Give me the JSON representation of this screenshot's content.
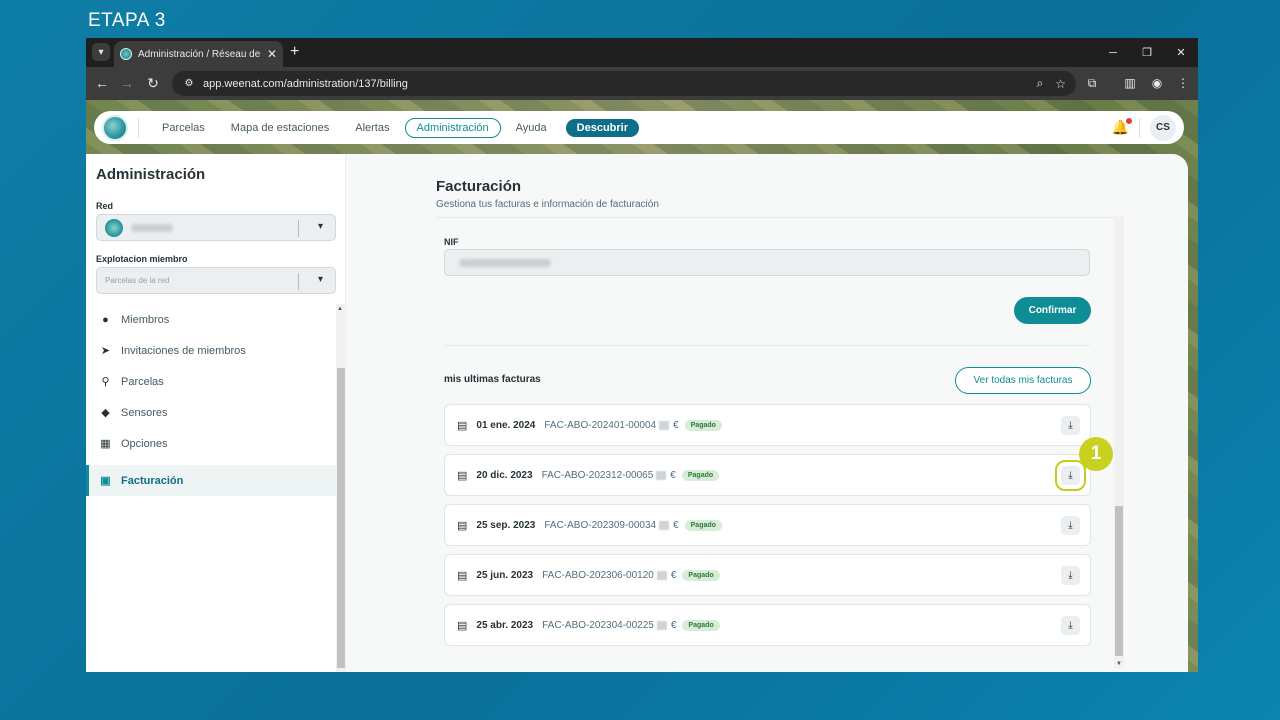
{
  "step_label": "ETAPA 3",
  "browser": {
    "tab_title": "Administración / Réseau de Dé",
    "url": "app.weenat.com/administration/137/billing"
  },
  "topnav": {
    "items": [
      "Parcelas",
      "Mapa de estaciones",
      "Alertas",
      "Administración",
      "Ayuda"
    ],
    "discover": "Descubrir",
    "avatar": "CS"
  },
  "sidebar": {
    "title": "Administración",
    "red_label": "Red",
    "member_label": "Explotacion miembro",
    "member_placeholder": "Parcelas de la red",
    "items": [
      {
        "label": "Miembros",
        "icon": "person-icon"
      },
      {
        "label": "Invitaciones de miembros",
        "icon": "send-icon"
      },
      {
        "label": "Parcelas",
        "icon": "parcel-icon"
      },
      {
        "label": "Sensores",
        "icon": "sensor-icon"
      },
      {
        "label": "Opciones",
        "icon": "options-icon"
      },
      {
        "label": "Facturación",
        "icon": "wallet-icon",
        "active": true
      }
    ]
  },
  "billing": {
    "title": "Facturación",
    "subtitle": "Gestiona tus facturas e información de facturación",
    "nif_label": "NIF",
    "confirm": "Confirmar",
    "invoices_title": "mis ultimas facturas",
    "view_all": "Ver todas mis facturas",
    "currency": "€",
    "invoices": [
      {
        "date": "01 ene. 2024",
        "number": "FAC-ABO-202401-00004",
        "status": "Pagado"
      },
      {
        "date": "20 dic. 2023",
        "number": "FAC-ABO-202312-00065",
        "status": "Pagado"
      },
      {
        "date": "25 sep. 2023",
        "number": "FAC-ABO-202309-00034",
        "status": "Pagado"
      },
      {
        "date": "25 jun. 2023",
        "number": "FAC-ABO-202306-00120",
        "status": "Pagado"
      },
      {
        "date": "25 abr. 2023",
        "number": "FAC-ABO-202304-00225",
        "status": "Pagado"
      }
    ]
  },
  "callout_number": "1",
  "colors": {
    "accent": "#0f8d96",
    "primary": "#0d6e8a",
    "callout": "#c7d21f",
    "paid_bg": "#d7ecd9"
  }
}
